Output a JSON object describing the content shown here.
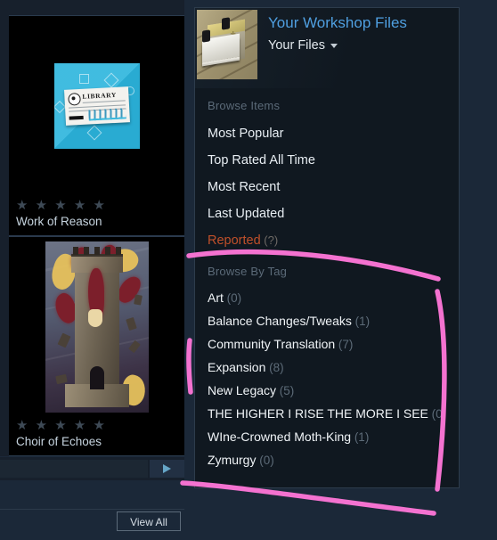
{
  "panel": {
    "title": "Your Workshop Files",
    "subtitle": "Your Files",
    "icon": "book-ledger-icon",
    "caret": "chevron-down-icon",
    "browse_items_heading": "Browse Items",
    "browse_items": [
      {
        "label": "Most Popular",
        "count": "",
        "style": "normal"
      },
      {
        "label": "Top Rated All Time",
        "count": "",
        "style": "normal"
      },
      {
        "label": "Most Recent",
        "count": "",
        "style": "normal"
      },
      {
        "label": "Last Updated",
        "count": "",
        "style": "normal"
      },
      {
        "label": "Reported",
        "count": "(?)",
        "style": "reported"
      }
    ],
    "browse_tags_heading": "Browse By Tag",
    "browse_tags": [
      {
        "label": "Art",
        "count": "(0)"
      },
      {
        "label": "Balance Changes/Tweaks",
        "count": "(1)"
      },
      {
        "label": "Community Translation",
        "count": "(7)"
      },
      {
        "label": "Expansion",
        "count": "(8)"
      },
      {
        "label": "New Legacy",
        "count": "(5)"
      },
      {
        "label": "THE HIGHER I RISE THE MORE I SEE",
        "count": "(0)"
      },
      {
        "label": "WIne-Crowned Moth-King",
        "count": "(1)"
      },
      {
        "label": "Zymurgy",
        "count": "(0)"
      }
    ]
  },
  "cards": [
    {
      "title": "Work of Reason",
      "stars": "★ ★ ★ ★ ★",
      "art": "library-card-art"
    },
    {
      "title": "Choir of Echoes",
      "stars": "★ ★ ★ ★ ★",
      "art": "tower-illustration-art"
    }
  ],
  "footer": {
    "view_all_label": "View All",
    "next_arrow_icon": "play-triangle-right-icon"
  },
  "colors": {
    "page_background": "#1b2838",
    "panel_background": "#101820",
    "panel_border": "#2d3c4c",
    "title_blue": "#4f9fe0",
    "heading_gray": "#5b6a78",
    "item_text": "#e8eef3",
    "count_gray": "#5d6b78",
    "reported_orange": "#c0502a",
    "annotation_pink": "#f472d0",
    "card_background": "#000000",
    "star_gray": "#3e4a56",
    "arrow_blue": "#66a6c8"
  },
  "annotations": {
    "type": "freehand-pink-marker",
    "stroke_color": "#f472d0",
    "strokes": [
      "horizontal line under Reported row",
      "vertical line down right side of tag list",
      "horizontal line under Zymurgy row",
      "short vertical tick at left of tag list"
    ]
  }
}
